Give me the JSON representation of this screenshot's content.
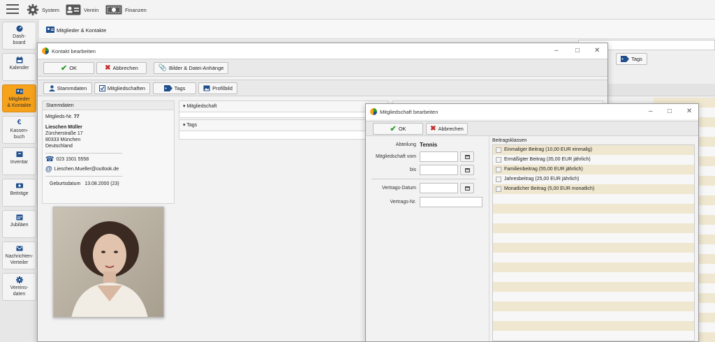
{
  "topbar": {
    "menu_icon": "hamburger-icon",
    "items": [
      {
        "label": "System",
        "icon": "gear-icon"
      },
      {
        "label": "Verein",
        "icon": "id-card-icon"
      },
      {
        "label": "Finanzen",
        "icon": "banknote-icon"
      }
    ]
  },
  "sidebar": {
    "items": [
      {
        "label": "Dash-\nboard",
        "icon": "dashboard-icon"
      },
      {
        "label": "Kalender",
        "icon": "calendar-icon"
      },
      {
        "label": "Mitglieder\n& Kontakte",
        "icon": "id-card-icon",
        "active": true
      },
      {
        "label": "Kassen-\nbuch",
        "icon": "euro-icon"
      },
      {
        "label": "Inventar",
        "icon": "box-icon"
      },
      {
        "label": "Beiträge",
        "icon": "money-icon"
      },
      {
        "label": "Jubiläen",
        "icon": "calendar-icon"
      },
      {
        "label": "Nachrichten-\nVerteiler",
        "icon": "mail-icon"
      },
      {
        "label": "Vereins-\ndaten",
        "icon": "gear-icon"
      }
    ]
  },
  "main": {
    "header": "Mitglieder & Kontakte",
    "tags_button": "Tags"
  },
  "contact_dialog": {
    "title": "Kontakt bearbeiten",
    "ok": "OK",
    "cancel": "Abbrechen",
    "attachments": "Bilder & Datei-Anhänge",
    "tabs": [
      "Stammdaten",
      "Mitgliedschaften",
      "Tags",
      "Profilbild"
    ],
    "stammdaten": {
      "heading": "Stammdaten",
      "member_no_label": "Mitglieds-Nr.",
      "member_no": "77",
      "name": "Lieschen Müller",
      "street": "Zürcherstraße 17",
      "city": "80333 München",
      "country": "Deutschland",
      "phone": "023 1501 5558",
      "email": "Lieschen.Mueller@outlook.de",
      "birth_label": "Geburtsdatum",
      "birth": "13.08.2000 (23)"
    },
    "sections": [
      "Mitgliedschaft",
      "Tags"
    ]
  },
  "membership_dialog": {
    "title": "Mitgliedschaft bearbeiten",
    "ok": "OK",
    "cancel": "Abbrechen",
    "abteilung_label": "Abteilung",
    "abteilung": "Tennis",
    "from_label": "Mitgliedschaft vom",
    "to_label": "bis",
    "contract_date_label": "Vertrags-Datum",
    "contract_no_label": "Vertrags-Nr.",
    "classes_heading": "Beitragsklassen",
    "classes": [
      "Einmaliger Beitrag (10,00 EUR einmalig)",
      "Ermäßigter Beitrag (35,00 EUR jährlich)",
      "Familienbeitrag (55,00 EUR jährlich)",
      "Jahresbeitrag (25,00 EUR jährlich)",
      "Monatlicher Beitrag (5,00 EUR monatlich)"
    ]
  },
  "colors": {
    "accent": "#f6a21a",
    "stripe": "#efe7cf",
    "ok_green": "#2e9b2e",
    "cancel_red": "#c62828",
    "icon_blue": "#1f4e8c"
  }
}
